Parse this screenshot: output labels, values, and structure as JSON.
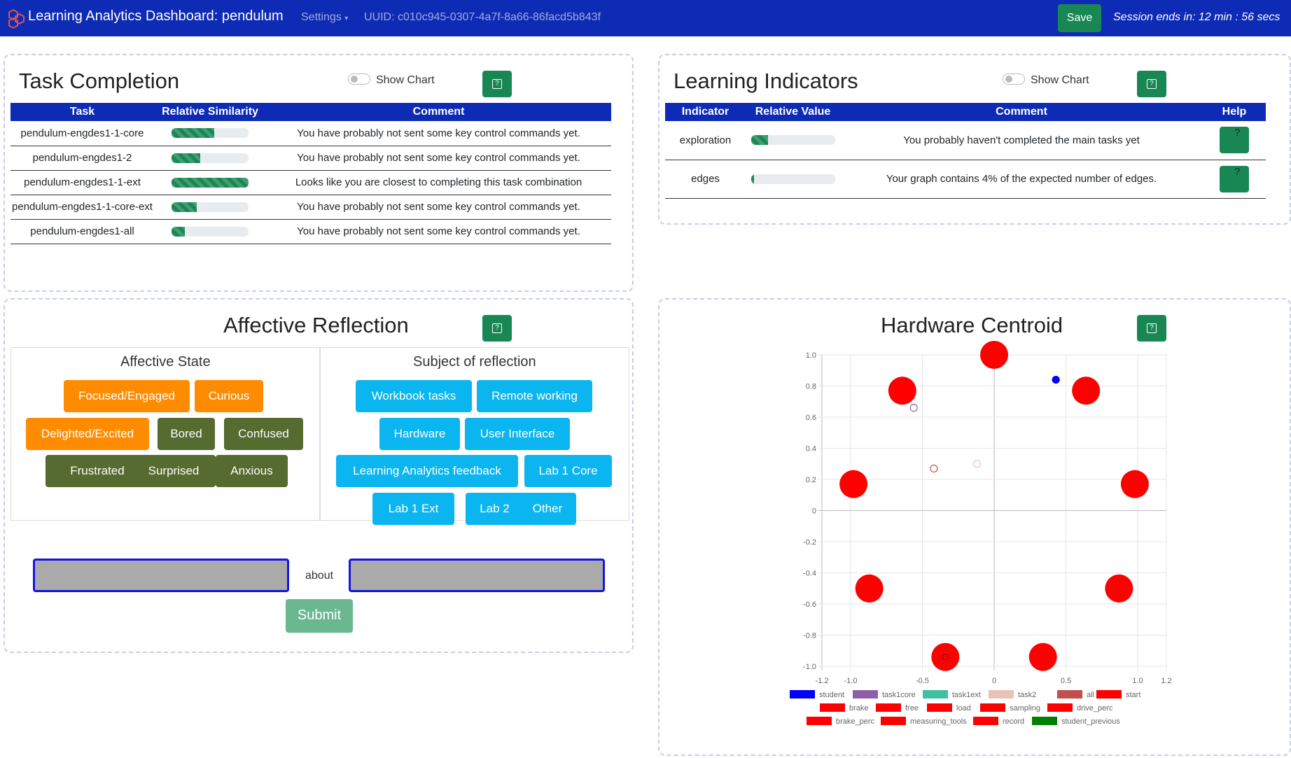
{
  "header": {
    "title": "Learning Analytics Dashboard: pendulum",
    "settings": "Settings",
    "uuid": "UUID: c010c945-0307-4a7f-8a66-86facd5b843f",
    "save": "Save",
    "session": "Session ends in: 12 min : 56 secs"
  },
  "task_completion": {
    "title": "Task Completion",
    "show_chart": "Show Chart",
    "help": "?",
    "columns": [
      "Task",
      "Relative Similarity",
      "Comment"
    ],
    "rows": [
      {
        "task": "pendulum-engdes1-1-core",
        "similarity": 0.55,
        "comment": "You have probably not sent some key control commands yet."
      },
      {
        "task": "pendulum-engdes1-2",
        "similarity": 0.37,
        "comment": "You have probably not sent some key control commands yet."
      },
      {
        "task": "pendulum-engdes1-1-ext",
        "similarity": 1.0,
        "comment": "Looks like you are closest to completing this task combination"
      },
      {
        "task": "pendulum-engdes1-1-core-ext",
        "similarity": 0.33,
        "comment": "You have probably not sent some key control commands yet."
      },
      {
        "task": "pendulum-engdes1-all",
        "similarity": 0.17,
        "comment": "You have probably not sent some key control commands yet."
      }
    ]
  },
  "learning_indicators": {
    "title": "Learning Indicators",
    "show_chart": "Show Chart",
    "help": "?",
    "columns": [
      "Indicator",
      "Relative Value",
      "Comment",
      "Help"
    ],
    "rows": [
      {
        "indicator": "exploration",
        "value": 0.2,
        "comment": "You probably haven't completed the main tasks yet"
      },
      {
        "indicator": "edges",
        "value": 0.04,
        "comment": "Your graph contains 4% of the expected number of edges."
      }
    ]
  },
  "affective_reflection": {
    "title": "Affective Reflection",
    "help": "?",
    "state_title": "Affective State",
    "subject_title": "Subject of reflection",
    "states": [
      {
        "label": "Focused/Engaged",
        "color": "#ff8c00"
      },
      {
        "label": "Curious",
        "color": "#ff8c00"
      },
      {
        "label": "Delighted/Excited",
        "color": "#ff8c00"
      },
      {
        "label": "Bored",
        "color": "#556b2f"
      },
      {
        "label": "Confused",
        "color": "#556b2f"
      },
      {
        "label": "Frustrated",
        "color": "#556b2f"
      },
      {
        "label": "Surprised",
        "color": "#556b2f"
      },
      {
        "label": "Anxious",
        "color": "#556b2f"
      }
    ],
    "subjects": [
      "Workbook tasks",
      "Remote working",
      "Hardware",
      "User Interface",
      "Learning Analytics feedback",
      "Lab 1 Core",
      "Lab 1 Ext",
      "Lab 2",
      "Other"
    ],
    "about": "about",
    "submit": "Submit"
  },
  "hardware_centroid": {
    "title": "Hardware Centroid",
    "help": "?"
  },
  "chart_data": {
    "type": "scatter",
    "title": "Hardware Centroid",
    "xlim": [
      -1.2,
      1.2
    ],
    "ylim": [
      -1.0,
      1.0
    ],
    "xticks": [
      "-1.2",
      "-1.0",
      "-0.5",
      "0",
      "0.5",
      "1.0",
      "1.2"
    ],
    "yticks": [
      "1.0",
      "0.8",
      "0.6",
      "0.4",
      "0.2",
      "0",
      "-0.2",
      "-0.4",
      "-0.6",
      "-0.8",
      "-1.0"
    ],
    "grid": true,
    "legend_position": "bottom",
    "series": [
      {
        "name": "student",
        "color": "#0000ff",
        "points": [
          [
            0.43,
            0.84
          ]
        ]
      },
      {
        "name": "task1core",
        "color": "#8f5fa6",
        "points": [
          [
            -0.56,
            0.66
          ]
        ]
      },
      {
        "name": "task1ext",
        "color": "#40c0a0",
        "points": []
      },
      {
        "name": "task2",
        "color": "#e9c1b8",
        "points": [
          [
            -0.12,
            0.3
          ]
        ]
      },
      {
        "name": "all",
        "color": "#c0504d",
        "points": [
          [
            -0.42,
            0.27
          ]
        ]
      },
      {
        "name": "start",
        "color": "#ff0000",
        "points": [
          [
            0.0,
            1.0
          ]
        ]
      },
      {
        "name": "brake",
        "color": "#ff0000",
        "points": [
          [
            0.64,
            0.77
          ]
        ]
      },
      {
        "name": "free",
        "color": "#ff0000",
        "points": [
          [
            -0.64,
            0.77
          ]
        ]
      },
      {
        "name": "load",
        "color": "#ff0000",
        "points": [
          [
            0.98,
            0.17
          ]
        ]
      },
      {
        "name": "sampling",
        "color": "#ff0000",
        "points": [
          [
            -0.98,
            0.17
          ]
        ]
      },
      {
        "name": "drive_perc",
        "color": "#ff0000",
        "points": [
          [
            0.87,
            -0.5
          ]
        ]
      },
      {
        "name": "brake_perc",
        "color": "#ff0000",
        "points": [
          [
            -0.87,
            -0.5
          ]
        ]
      },
      {
        "name": "measuring_tools",
        "color": "#ff0000",
        "points": [
          [
            0.34,
            -0.94
          ]
        ]
      },
      {
        "name": "record",
        "color": "#ff0000",
        "points": [
          [
            -0.34,
            -0.94
          ]
        ]
      },
      {
        "name": "student_previous",
        "color": "#008000",
        "points": []
      }
    ]
  }
}
